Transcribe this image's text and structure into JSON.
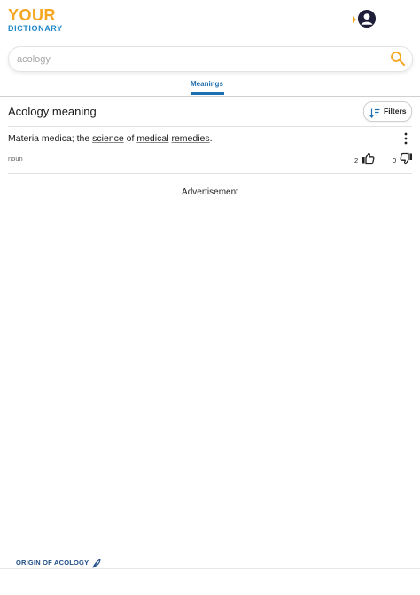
{
  "brand": {
    "line1": "YOUR",
    "line2": "DICTIONARY",
    "accent": "#f5a623",
    "blue": "#1e88c8"
  },
  "header": {
    "account_icon": "user-circle-icon",
    "caret_icon": "caret-right-icon"
  },
  "search": {
    "value": "",
    "placeholder": "acology",
    "icon": "search-icon"
  },
  "tabs": [
    {
      "label": "Meanings",
      "active": true
    }
  ],
  "entry": {
    "word": "Acology",
    "heading_suffix": " meaning",
    "filters_label": "Filters",
    "definition": {
      "pre": "Materia medica; the ",
      "link1": "science",
      "mid": " of ",
      "link2": "medical",
      "space": " ",
      "link3": "remedies",
      "post": "."
    },
    "part_of_speech": "noun",
    "upvotes": "2",
    "downvotes": "0"
  },
  "advertisement": "Advertisement",
  "origin": {
    "label": "ORIGIN OF ACOLOGY",
    "icon": "feather-icon"
  }
}
